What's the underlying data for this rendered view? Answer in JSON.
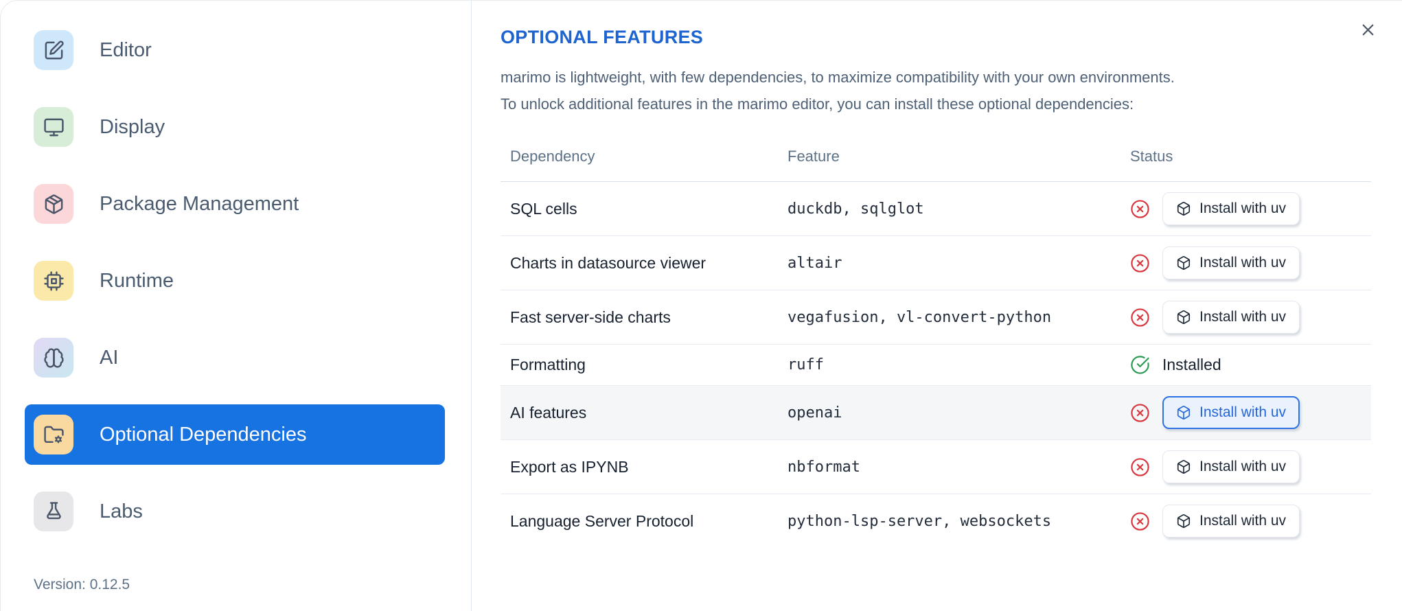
{
  "sidebar": {
    "items": [
      {
        "id": "editor",
        "label": "Editor",
        "icon": "square-pen",
        "icon_bg": "#cfe7fb",
        "selected": false
      },
      {
        "id": "display",
        "label": "Display",
        "icon": "monitor",
        "icon_bg": "#d7edd8",
        "selected": false
      },
      {
        "id": "package-management",
        "label": "Package Management",
        "icon": "package",
        "icon_bg": "#fbd7da",
        "selected": false
      },
      {
        "id": "runtime",
        "label": "Runtime",
        "icon": "cpu",
        "icon_bg": "#fbe9a9",
        "selected": false
      },
      {
        "id": "ai",
        "label": "AI",
        "icon": "brain",
        "icon_bg": "#e2d9f5",
        "icon_bg2": "#c8e7f0",
        "selected": false
      },
      {
        "id": "optional-dependencies",
        "label": "Optional Dependencies",
        "icon": "folder-cog",
        "icon_bg": "#f9d9a0",
        "selected": true
      },
      {
        "id": "labs",
        "label": "Labs",
        "icon": "flask",
        "icon_bg": "#e7e7ea",
        "selected": false
      }
    ],
    "version_label": "Version: 0.12.5"
  },
  "main": {
    "title": "OPTIONAL FEATURES",
    "description": [
      "marimo is lightweight, with few dependencies, to maximize compatibility with your own environments.",
      "To unlock additional features in the marimo editor, you can install these optional dependencies:"
    ],
    "table": {
      "columns": [
        "Dependency",
        "Feature",
        "Status"
      ],
      "install_button_label": "Install with uv",
      "installed_label": "Installed",
      "rows": [
        {
          "dependency": "SQL cells",
          "feature": "duckdb, sqlglot",
          "installed": false,
          "highlighted": false,
          "focused": false
        },
        {
          "dependency": "Charts in datasource viewer",
          "feature": "altair",
          "installed": false,
          "highlighted": false,
          "focused": false
        },
        {
          "dependency": "Fast server-side charts",
          "feature": "vegafusion, vl-convert-python",
          "installed": false,
          "highlighted": false,
          "focused": false
        },
        {
          "dependency": "Formatting",
          "feature": "ruff",
          "installed": true,
          "highlighted": false,
          "focused": false
        },
        {
          "dependency": "AI features",
          "feature": "openai",
          "installed": false,
          "highlighted": true,
          "focused": true
        },
        {
          "dependency": "Export as IPYNB",
          "feature": "nbformat",
          "installed": false,
          "highlighted": false,
          "focused": false
        },
        {
          "dependency": "Language Server Protocol",
          "feature": "python-lsp-server, websockets",
          "installed": false,
          "highlighted": false,
          "focused": false
        }
      ]
    }
  },
  "colors": {
    "accent_selected": "#1772e2",
    "title_blue": "#1d64d1",
    "focus_blue": "#2e72e5",
    "status_missing_red": "#d9363e",
    "status_installed_green": "#2b9b51"
  }
}
